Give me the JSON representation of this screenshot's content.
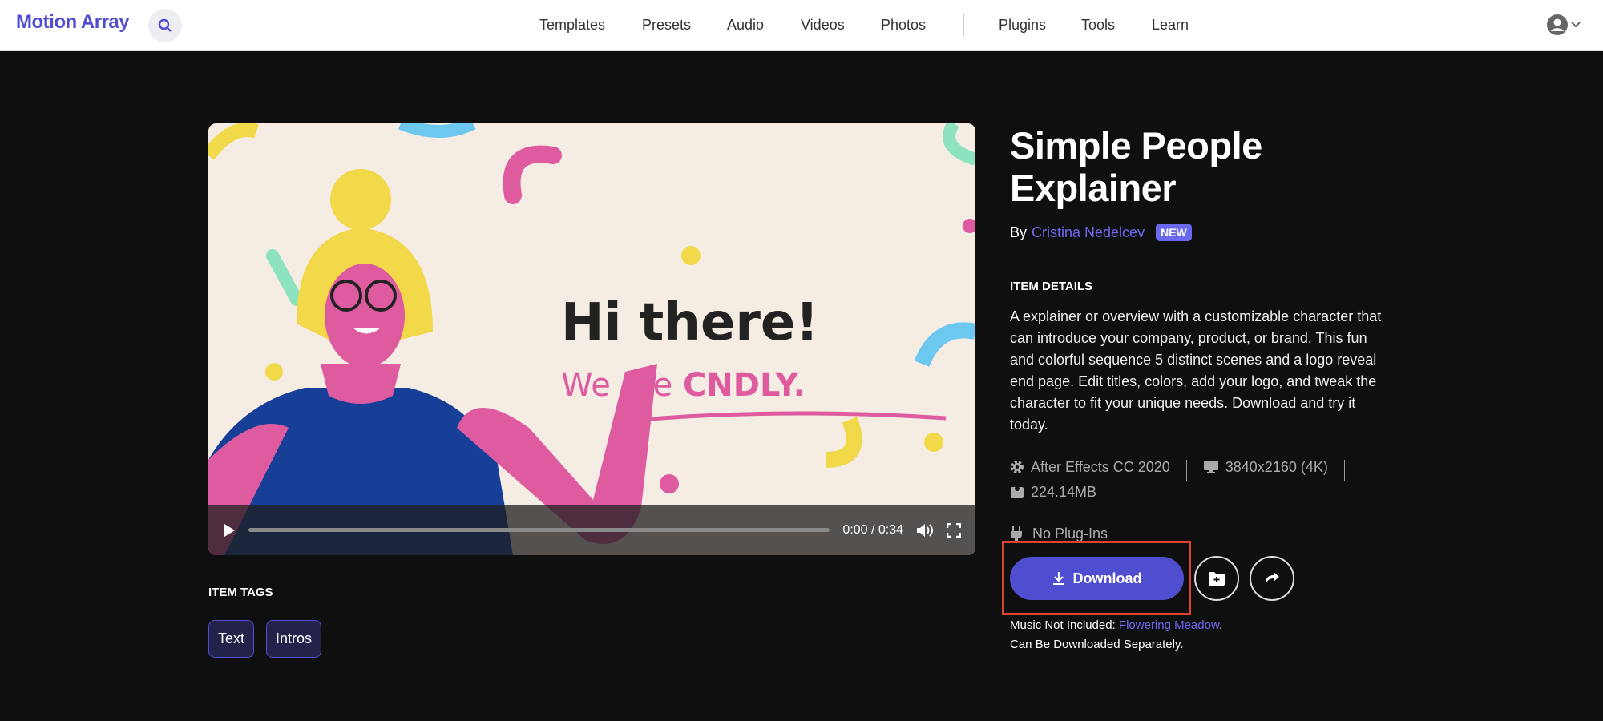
{
  "header": {
    "logo": "Motion Array",
    "nav": [
      "Templates",
      "Presets",
      "Audio",
      "Videos",
      "Photos",
      "Plugins",
      "Tools",
      "Learn"
    ]
  },
  "video": {
    "headline": "Hi there!",
    "subline_prefix": "We are ",
    "subline_brand": "CNDLY.",
    "time": "0:00 / 0:34",
    "progress": 0
  },
  "item": {
    "title_line1": "Simple People",
    "title_line2": "Explainer",
    "by": "By",
    "author": "Cristina Nedelcev",
    "badge": "NEW",
    "details_label": "ITEM DETAILS",
    "description": "A explainer or overview with a customizable character that can introduce your company, product, or brand. This fun and colorful sequence 5 distinct scenes and a logo reveal end page. Edit titles, colors, add your logo, and tweak the character to fit your unique needs. Download and try it today.",
    "software": "After Effects CC 2020",
    "resolution": "3840x2160 (4K)",
    "size": "224.14MB",
    "plugins": "No Plug-Ins",
    "download": "Download",
    "music_label": "Music Not Included:",
    "music_track": "Flowering Meadow",
    "music_end": ".",
    "music_note": "Can Be Downloaded Separately."
  },
  "tags": {
    "label": "ITEM TAGS",
    "items": [
      "Text",
      "Intros"
    ]
  },
  "colors": {
    "accent": "#4f4dd0",
    "link": "#6b68f0",
    "highlight": "#e0412d"
  }
}
